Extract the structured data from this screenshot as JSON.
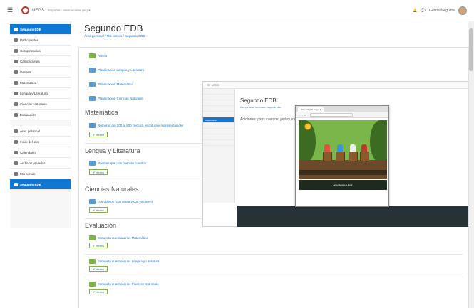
{
  "navbar": {
    "site_name": "UEGS",
    "language": "Español - Internacional (es) ▾",
    "user_name": "Gabriela Aguirre"
  },
  "drawer": {
    "items": [
      {
        "label": "Segundo EDB",
        "active": true
      },
      {
        "label": "Participantes",
        "active": false
      },
      {
        "label": "Competencias",
        "active": false
      },
      {
        "label": "Calificaciones",
        "active": false
      },
      {
        "label": "General",
        "active": false
      },
      {
        "label": "Matemática",
        "active": false
      },
      {
        "label": "Lengua y Literatura",
        "active": false
      },
      {
        "label": "Ciencias Naturales",
        "active": false
      },
      {
        "label": "Evaluación",
        "active": false
      }
    ],
    "items2": [
      {
        "label": "Área personal",
        "active": false
      },
      {
        "label": "Inicio del sitio",
        "active": false
      },
      {
        "label": "Calendario",
        "active": false
      },
      {
        "label": "Archivos privados",
        "active": false
      },
      {
        "label": "Mis cursos",
        "active": false
      },
      {
        "label": "Segundo EDB",
        "active": true
      }
    ]
  },
  "page": {
    "title": "Segundo EDB",
    "breadcrumb": "Área personal / Mis cursos / Segundo EDB"
  },
  "course": {
    "general_items": [
      "Avisos",
      "Planificación Lengua y Literatura",
      "Planificación Matemática",
      "Planificación Ciencias Naturales"
    ],
    "sections": [
      {
        "title": "Matemática",
        "activity": "Números del 200 al 600 (lectura, escritura y representación)",
        "status": "Hecho"
      },
      {
        "title": "Lengua y Literatura",
        "activity": "Poemas que nos cuentan cuentos",
        "status": "Hecho"
      },
      {
        "title": "Ciencias Naturales",
        "activity": "Los objetos (con masa y con volumen)",
        "status": "Hecho"
      },
      {
        "title": "Evaluación",
        "activity": "Encuesta cuestionarios Matemática",
        "status": "Hecho"
      }
    ],
    "eval_items": [
      {
        "activity": "Encuesta cuestionarios Lengua y Literatura",
        "status": "Hecho"
      },
      {
        "activity": "Encuesta cuestionarios Ciencias Naturales",
        "status": "Hecho"
      }
    ]
  },
  "embed": {
    "title": "Segundo EDB",
    "subtitle": "Adiciones y sus cuentos, jerárquicas",
    "side_active": "Matemática"
  },
  "popup": {
    "tab": "Clase Digital Juego 1",
    "game_footer": "Aprendemos a jugar"
  },
  "colors": {
    "accent": "#1177d1",
    "done": "#7cb342"
  }
}
